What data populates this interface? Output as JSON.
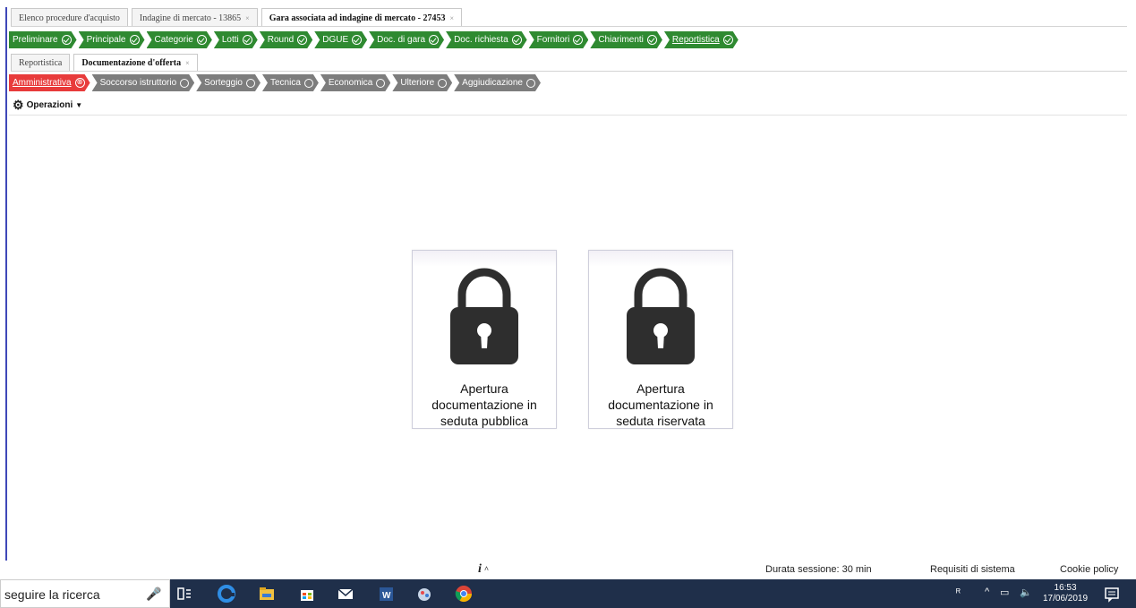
{
  "top_tabs": [
    {
      "label": "Elenco procedure d'acquisto",
      "close": ""
    },
    {
      "label": "Indagine di mercato - 13865",
      "close": "×"
    },
    {
      "label": "Gara associata ad indagine di mercato - 27453",
      "close": "×"
    }
  ],
  "steps": [
    "Preliminare",
    "Principale",
    "Categorie",
    "Lotti",
    "Round",
    "DGUE",
    "Doc. di gara",
    "Doc. richiesta",
    "Fornitori",
    "Chiarimenti",
    "Reportistica"
  ],
  "sub_tabs": [
    {
      "label": "Reportistica",
      "close": ""
    },
    {
      "label": "Documentazione d'offerta",
      "close": "×"
    }
  ],
  "phases": [
    {
      "label": "Amministrativa",
      "mark": "⊗"
    },
    {
      "label": "Soccorso istruttorio"
    },
    {
      "label": "Sorteggio"
    },
    {
      "label": "Tecnica"
    },
    {
      "label": "Economica"
    },
    {
      "label": "Ulteriore"
    },
    {
      "label": "Aggiudicazione"
    }
  ],
  "operations": {
    "label": "Operazioni"
  },
  "cards": [
    {
      "label": "Apertura documentazione in seduta pubblica"
    },
    {
      "label": "Apertura documentazione in seduta riservata"
    }
  ],
  "footer": {
    "info": "i",
    "caret": "^",
    "session": "Durata sessione: 30 min",
    "requirements": "Requisiti di sistema",
    "cookie": "Cookie policy"
  },
  "taskbar": {
    "search": "seguire la ricerca",
    "time": "16:53",
    "date": "17/06/2019"
  },
  "colors": {
    "done": "#2f8a31",
    "active_phase": "#e83b3b",
    "phase": "#7d7d7d",
    "taskbar": "#1f2f4a"
  },
  "icons": [
    "gear-icon",
    "lock-icon",
    "microphone-icon",
    "task-view-icon",
    "edge-icon",
    "file-explorer-icon",
    "store-icon",
    "mail-icon",
    "word-icon",
    "paint-icon",
    "chrome-icon",
    "notification-icon"
  ]
}
